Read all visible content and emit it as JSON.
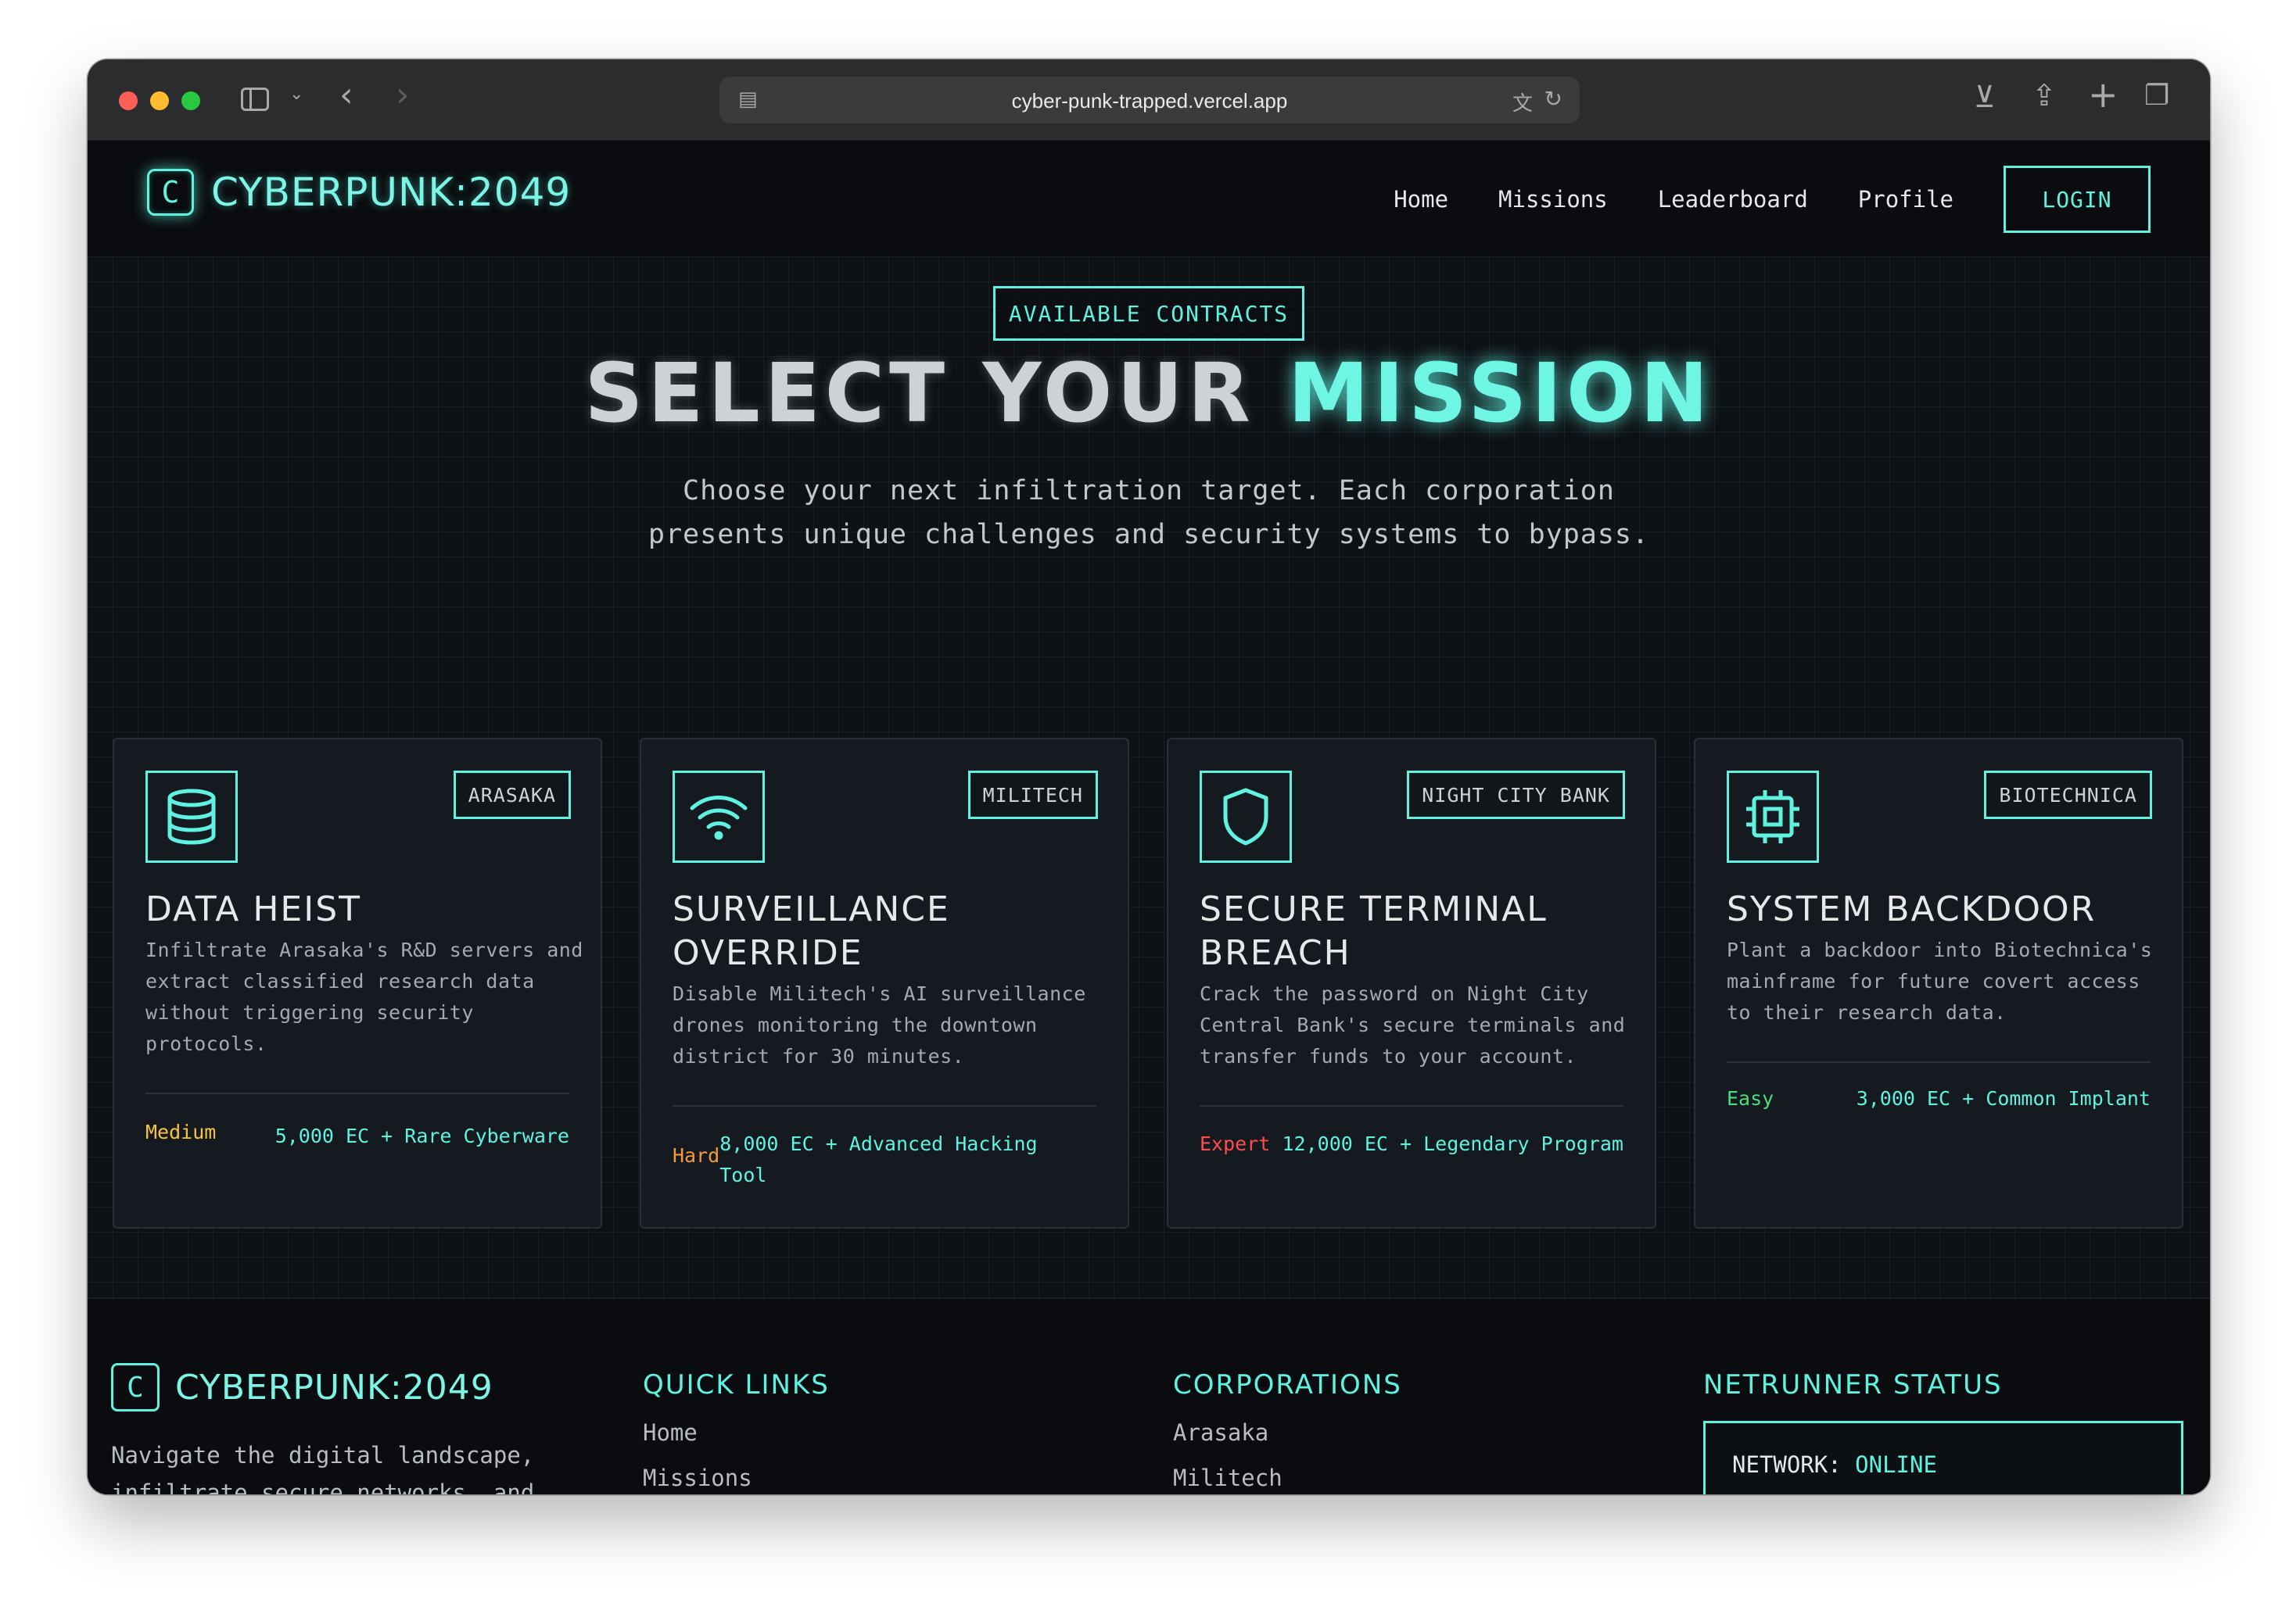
{
  "browser": {
    "url": "cyber-punk-trapped.vercel.app"
  },
  "nav": {
    "logo_glyph": "C",
    "logo_text": "CYBERPUNK:2049",
    "links": [
      "Home",
      "Missions",
      "Leaderboard",
      "Profile"
    ],
    "login_label": "LOGIN"
  },
  "hero": {
    "badge": "AVAILABLE CONTRACTS",
    "title_main": "SELECT YOUR ",
    "title_accent": "MISSION",
    "subtitle": "Choose your next infiltration target. Each corporation presents unique challenges and security systems to bypass."
  },
  "missions": [
    {
      "corp": "ARASAKA",
      "icon": "database-icon",
      "title": "DATA HEIST",
      "description": "Infiltrate Arasaka's R&D servers and extract classified research data without triggering security protocols.",
      "difficulty": "Medium",
      "difficulty_color": "#f5c542",
      "reward": "5,000 EC + Rare Cyberware"
    },
    {
      "corp": "MILITECH",
      "icon": "wifi-icon",
      "title": "SURVEILLANCE OVERRIDE",
      "description": "Disable Militech's AI surveillance drones monitoring the downtown district for 30 minutes.",
      "difficulty": "Hard",
      "difficulty_color": "#f59a3c",
      "reward": "8,000 EC + Advanced Hacking Tool"
    },
    {
      "corp": "NIGHT CITY BANK",
      "icon": "shield-icon",
      "title": "SECURE TERMINAL BREACH",
      "description": "Crack the password on Night City Central Bank's secure terminals and transfer funds to your account.",
      "difficulty": "Expert",
      "difficulty_color": "#ff4d4d",
      "reward": "12,000 EC + Legendary Program"
    },
    {
      "corp": "BIOTECHNICA",
      "icon": "cpu-chip-icon",
      "title": "SYSTEM BACKDOOR",
      "description": "Plant a backdoor into Biotechnica's mainframe for future covert access to their research data.",
      "difficulty": "Easy",
      "difficulty_color": "#4ade80",
      "reward": "3,000 EC + Common Implant"
    }
  ],
  "footer": {
    "logo_glyph": "C",
    "logo_text": "CYBERPUNK:2049",
    "tagline": "Navigate the digital landscape, infiltrate secure networks, and",
    "quick_links": {
      "heading": "QUICK LINKS",
      "items": [
        "Home",
        "Missions"
      ]
    },
    "corporations": {
      "heading": "CORPORATIONS",
      "items": [
        "Arasaka",
        "Militech"
      ]
    },
    "status": {
      "heading": "NETRUNNER STATUS",
      "label": "NETWORK:",
      "value": "ONLINE"
    }
  },
  "colors": {
    "accent": "#5ff2e0",
    "background": "#0c0e11",
    "card": "#151a20"
  }
}
